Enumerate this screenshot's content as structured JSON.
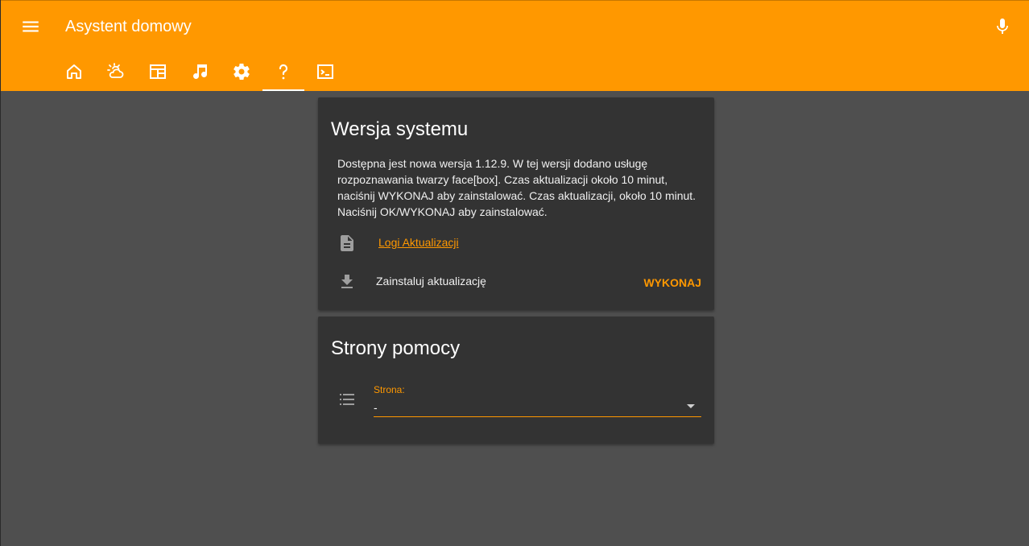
{
  "app": {
    "title": "Asystent domowy"
  },
  "header": {
    "menu_icon": "hamburger-menu-icon",
    "mic_icon": "microphone-icon",
    "accent": "#ff9800",
    "tabs": [
      {
        "icon": "home-icon"
      },
      {
        "icon": "weather-partly-cloudy-icon"
      },
      {
        "icon": "dashboard-table-icon"
      },
      {
        "icon": "music-note-icon"
      },
      {
        "icon": "settings-gear-icon"
      },
      {
        "icon": "help-question-icon",
        "active": true
      },
      {
        "icon": "console-terminal-icon"
      }
    ]
  },
  "system_version": {
    "title": "Wersja systemu",
    "description": "Dostępna jest nowa wersja 1.12.9. W tej wersji dodano usługę rozpoznawania twarzy face[box]. Czas aktualizacji około 10 minut, naciśnij WYKONAJ aby zainstalować. Czas aktualizacji, około 10 minut. Naciśnij OK/WYKONAJ aby zainstalować.",
    "log_link": "Logi Aktualizacji",
    "install_label": "Zainstaluj aktualizację",
    "run_button": "WYKONAJ"
  },
  "help_pages": {
    "title": "Strony pomocy",
    "field_label": "Strona:",
    "field_value": "-"
  }
}
